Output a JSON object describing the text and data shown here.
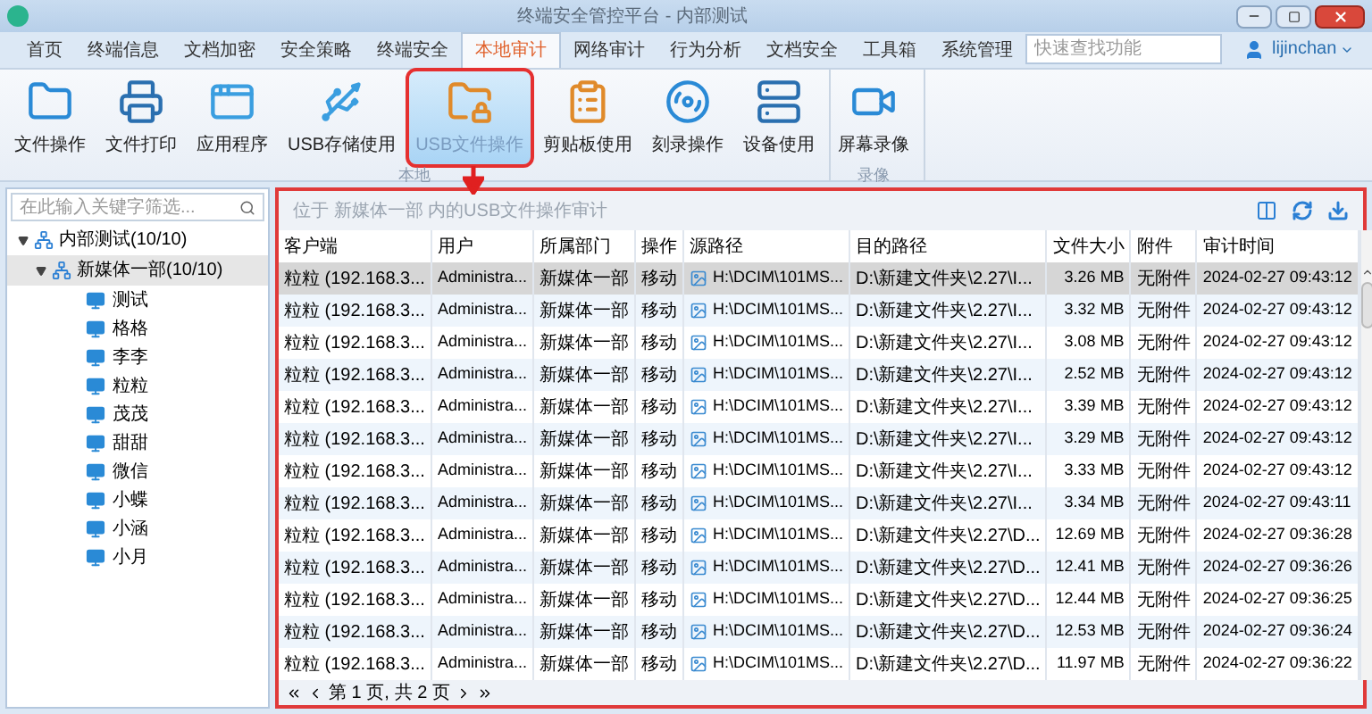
{
  "window": {
    "title": "终端安全管控平台 - 内部测试"
  },
  "tabs": [
    {
      "label": "首页",
      "selected": false
    },
    {
      "label": "终端信息",
      "selected": false
    },
    {
      "label": "文档加密",
      "selected": false
    },
    {
      "label": "安全策略",
      "selected": false
    },
    {
      "label": "终端安全",
      "selected": false
    },
    {
      "label": "本地审计",
      "selected": true
    },
    {
      "label": "网络审计",
      "selected": false
    },
    {
      "label": "行为分析",
      "selected": false
    },
    {
      "label": "文档安全",
      "selected": false
    },
    {
      "label": "工具箱",
      "selected": false
    },
    {
      "label": "系统管理",
      "selected": false
    }
  ],
  "search": {
    "placeholder": "快速查找功能"
  },
  "user": {
    "name": "lijinchan"
  },
  "ribbon_groups": [
    {
      "label": "本地",
      "items": [
        {
          "label": "文件操作",
          "kind": "file",
          "selected": false
        },
        {
          "label": "文件打印",
          "kind": "print",
          "selected": false
        },
        {
          "label": "应用程序",
          "kind": "app",
          "selected": false
        },
        {
          "label": "USB存储使用",
          "kind": "usb",
          "selected": false
        },
        {
          "label": "USB文件操作",
          "kind": "usbfile",
          "selected": true
        },
        {
          "label": "剪贴板使用",
          "kind": "clipboard",
          "selected": false
        },
        {
          "label": "刻录操作",
          "kind": "disc",
          "selected": false
        },
        {
          "label": "设备使用",
          "kind": "device",
          "selected": false
        }
      ]
    },
    {
      "label": "录像",
      "items": [
        {
          "label": "屏幕录像",
          "kind": "video",
          "selected": false
        }
      ]
    }
  ],
  "tree": {
    "filter_placeholder": "在此输入关键字筛选...",
    "nodes": [
      {
        "label": "内部测试(10/10)",
        "expanded": true,
        "selected": false,
        "children": [
          {
            "label": "新媒体一部(10/10)",
            "expanded": true,
            "selected": true,
            "children": [
              {
                "label": "测试"
              },
              {
                "label": "格格"
              },
              {
                "label": "李李"
              },
              {
                "label": "粒粒"
              },
              {
                "label": "茂茂"
              },
              {
                "label": "甜甜"
              },
              {
                "label": "微信"
              },
              {
                "label": "小蝶"
              },
              {
                "label": "小涵"
              },
              {
                "label": "小月"
              }
            ]
          }
        ]
      }
    ]
  },
  "breadcrumb": "位于 新媒体一部 内的USB文件操作审计",
  "table": {
    "columns": [
      "客户端",
      "用户",
      "所属部门",
      "操作",
      "源路径",
      "目的路径",
      "文件大小",
      "附件",
      "审计时间"
    ],
    "rows": [
      {
        "selected": true,
        "cells": [
          "粒粒 (192.168.3...",
          "Administra...",
          "新媒体一部",
          "移动",
          "H:\\DCIM\\101MS...",
          "D:\\新建文件夹\\2.27\\I...",
          "3.26 MB",
          "无附件",
          "2024-02-27 09:43:12"
        ]
      },
      {
        "selected": false,
        "cells": [
          "粒粒 (192.168.3...",
          "Administra...",
          "新媒体一部",
          "移动",
          "H:\\DCIM\\101MS...",
          "D:\\新建文件夹\\2.27\\I...",
          "3.32 MB",
          "无附件",
          "2024-02-27 09:43:12"
        ]
      },
      {
        "selected": false,
        "cells": [
          "粒粒 (192.168.3...",
          "Administra...",
          "新媒体一部",
          "移动",
          "H:\\DCIM\\101MS...",
          "D:\\新建文件夹\\2.27\\I...",
          "3.08 MB",
          "无附件",
          "2024-02-27 09:43:12"
        ]
      },
      {
        "selected": false,
        "cells": [
          "粒粒 (192.168.3...",
          "Administra...",
          "新媒体一部",
          "移动",
          "H:\\DCIM\\101MS...",
          "D:\\新建文件夹\\2.27\\I...",
          "2.52 MB",
          "无附件",
          "2024-02-27 09:43:12"
        ]
      },
      {
        "selected": false,
        "cells": [
          "粒粒 (192.168.3...",
          "Administra...",
          "新媒体一部",
          "移动",
          "H:\\DCIM\\101MS...",
          "D:\\新建文件夹\\2.27\\I...",
          "3.39 MB",
          "无附件",
          "2024-02-27 09:43:12"
        ]
      },
      {
        "selected": false,
        "cells": [
          "粒粒 (192.168.3...",
          "Administra...",
          "新媒体一部",
          "移动",
          "H:\\DCIM\\101MS...",
          "D:\\新建文件夹\\2.27\\I...",
          "3.29 MB",
          "无附件",
          "2024-02-27 09:43:12"
        ]
      },
      {
        "selected": false,
        "cells": [
          "粒粒 (192.168.3...",
          "Administra...",
          "新媒体一部",
          "移动",
          "H:\\DCIM\\101MS...",
          "D:\\新建文件夹\\2.27\\I...",
          "3.33 MB",
          "无附件",
          "2024-02-27 09:43:12"
        ]
      },
      {
        "selected": false,
        "cells": [
          "粒粒 (192.168.3...",
          "Administra...",
          "新媒体一部",
          "移动",
          "H:\\DCIM\\101MS...",
          "D:\\新建文件夹\\2.27\\I...",
          "3.34 MB",
          "无附件",
          "2024-02-27 09:43:11"
        ]
      },
      {
        "selected": false,
        "cells": [
          "粒粒 (192.168.3...",
          "Administra...",
          "新媒体一部",
          "移动",
          "H:\\DCIM\\101MS...",
          "D:\\新建文件夹\\2.27\\D...",
          "12.69 MB",
          "无附件",
          "2024-02-27 09:36:28"
        ]
      },
      {
        "selected": false,
        "cells": [
          "粒粒 (192.168.3...",
          "Administra...",
          "新媒体一部",
          "移动",
          "H:\\DCIM\\101MS...",
          "D:\\新建文件夹\\2.27\\D...",
          "12.41 MB",
          "无附件",
          "2024-02-27 09:36:26"
        ]
      },
      {
        "selected": false,
        "cells": [
          "粒粒 (192.168.3...",
          "Administra...",
          "新媒体一部",
          "移动",
          "H:\\DCIM\\101MS...",
          "D:\\新建文件夹\\2.27\\D...",
          "12.44 MB",
          "无附件",
          "2024-02-27 09:36:25"
        ]
      },
      {
        "selected": false,
        "cells": [
          "粒粒 (192.168.3...",
          "Administra...",
          "新媒体一部",
          "移动",
          "H:\\DCIM\\101MS...",
          "D:\\新建文件夹\\2.27\\D...",
          "12.53 MB",
          "无附件",
          "2024-02-27 09:36:24"
        ]
      },
      {
        "selected": false,
        "cells": [
          "粒粒 (192.168.3...",
          "Administra...",
          "新媒体一部",
          "移动",
          "H:\\DCIM\\101MS...",
          "D:\\新建文件夹\\2.27\\D...",
          "11.97 MB",
          "无附件",
          "2024-02-27 09:36:22"
        ]
      }
    ]
  },
  "pager": {
    "current": "第 1 页,",
    "total": "共 2 页"
  }
}
